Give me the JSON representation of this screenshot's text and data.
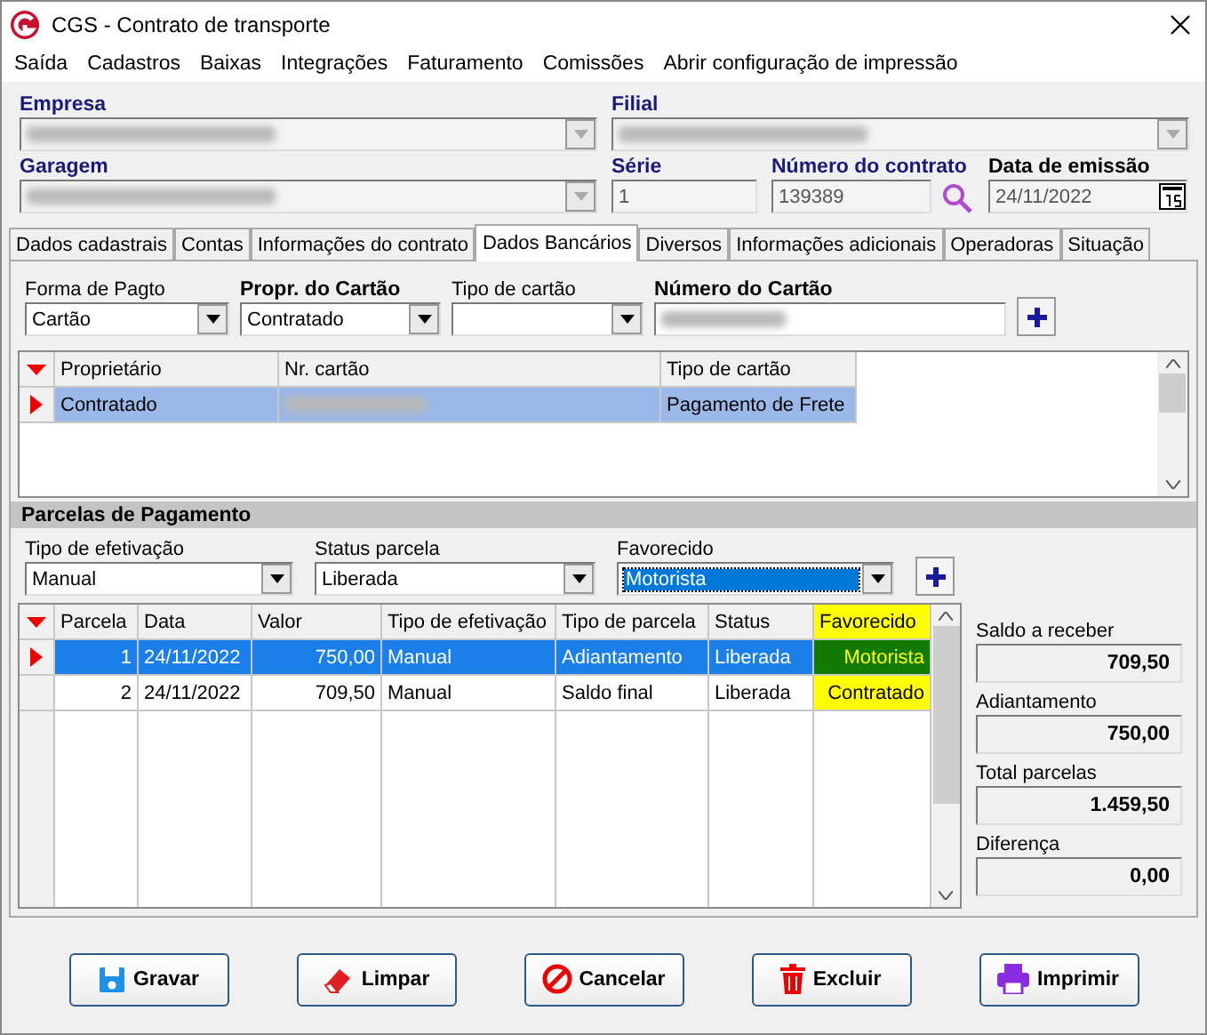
{
  "window": {
    "title": "CGS - Contrato de transporte"
  },
  "menu": [
    "Saída",
    "Cadastros",
    "Baixas",
    "Integrações",
    "Faturamento",
    "Comissões",
    "Abrir configuração de impressão"
  ],
  "header": {
    "empresa": {
      "label": "Empresa",
      "redacted": true
    },
    "filial": {
      "label": "Filial",
      "redacted": true
    },
    "garagem": {
      "label": "Garagem",
      "redacted": true
    },
    "serie": {
      "label": "Série",
      "value": "1"
    },
    "numero": {
      "label": "Número do contrato",
      "value": "139389"
    },
    "data": {
      "label": "Data de emissão",
      "value": "24/11/2022"
    }
  },
  "tabs": [
    {
      "label": "Dados cadastrais",
      "selected": false
    },
    {
      "label": "Contas",
      "selected": false
    },
    {
      "label": "Informações do contrato",
      "selected": false
    },
    {
      "label": "Dados Bancários",
      "selected": true
    },
    {
      "label": "Diversos",
      "selected": false
    },
    {
      "label": "Informações adicionais",
      "selected": false
    },
    {
      "label": "Operadoras",
      "selected": false
    },
    {
      "label": "Situação",
      "selected": false
    }
  ],
  "banking": {
    "fields": [
      {
        "label": "Forma de Pagto",
        "value": "Cartão",
        "kind": "combo",
        "required": false
      },
      {
        "label": "Propr. do Cartão",
        "value": "Contratado",
        "kind": "combo",
        "required": true
      },
      {
        "label": "Tipo de cartão",
        "kind": "combo",
        "required": false
      },
      {
        "label": "Número do Cartão",
        "kind": "text",
        "required": true,
        "redacted": true
      }
    ],
    "columns": [
      "Proprietário",
      "Nr. cartão",
      "Tipo de cartão"
    ],
    "rows": [
      {
        "owner": "Contratado",
        "number_redacted": true,
        "type": "Pagamento de Frete",
        "selected": true
      }
    ]
  },
  "parcelas": {
    "title": "Parcelas de Pagamento",
    "filters": [
      {
        "label": "Tipo de efetivação",
        "value": "Manual",
        "focused": false
      },
      {
        "label": "Status parcela",
        "value": "Liberada",
        "focused": false
      },
      {
        "label": "Favorecido",
        "value": "Motorista",
        "focused": true
      }
    ],
    "columns": [
      {
        "label": "Parcela"
      },
      {
        "label": "Data"
      },
      {
        "label": "Valor"
      },
      {
        "label": "Tipo de efetivação"
      },
      {
        "label": "Tipo de parcela"
      },
      {
        "label": "Status"
      },
      {
        "label": "Favorecido",
        "color": "#ffff00"
      }
    ],
    "rows": [
      {
        "selected": true,
        "cells": [
          "1",
          "24/11/2022",
          "750,00",
          "Manual",
          "Adiantamento",
          "Liberada",
          "Motorista"
        ],
        "color": "#117a00"
      },
      {
        "selected": false,
        "cells": [
          "2",
          "24/11/2022",
          "709,50",
          "Manual",
          "Saldo final",
          "Liberada",
          "Contratado"
        ],
        "color": "#ffff00"
      }
    ],
    "summary": [
      {
        "label": "Saldo a receber",
        "value": "709,50"
      },
      {
        "label": "Adiantamento",
        "value": "750,00"
      },
      {
        "label": "Total parcelas",
        "value": "1.459,50"
      },
      {
        "label": "Diferença",
        "value": "0,00"
      }
    ]
  },
  "buttons": [
    {
      "label": "Gravar",
      "kind": "save"
    },
    {
      "label": "Limpar",
      "kind": "clear"
    },
    {
      "label": "Cancelar",
      "kind": "cancel"
    },
    {
      "label": "Excluir",
      "kind": "delete"
    },
    {
      "label": "Imprimir",
      "kind": "print"
    }
  ]
}
